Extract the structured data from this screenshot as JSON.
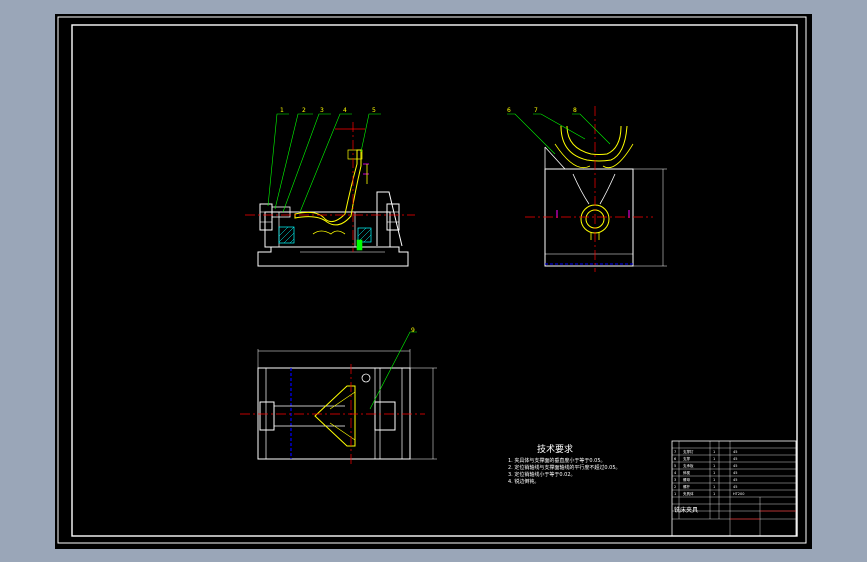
{
  "drawing": {
    "technical_requirements": {
      "title": "技术要求",
      "items": [
        "1. 夹具体与支撑面的垂直度小于等于0.05。",
        "2. 定位销轴线与支撑面轴线的平行度不超过0.05。",
        "3. 定位销轴线小于等于0.02。",
        "4. 锐边倒钝。"
      ]
    },
    "part_labels": [
      "1",
      "2",
      "3",
      "4",
      "5",
      "6",
      "7",
      "8",
      "9"
    ],
    "title_block": {
      "drawing_name": "铣床夹具",
      "rows": [
        {
          "col1": "7",
          "col2": "支撑钉",
          "col3": "1",
          "col4": "45"
        },
        {
          "col1": "6",
          "col2": "支撑",
          "col3": "1",
          "col4": "45"
        },
        {
          "col1": "5",
          "col2": "支承板",
          "col3": "1",
          "col4": "45"
        },
        {
          "col1": "4",
          "col2": "斜楔",
          "col3": "1",
          "col4": "45"
        },
        {
          "col1": "3",
          "col2": "螺母",
          "col3": "1",
          "col4": "45"
        },
        {
          "col1": "2",
          "col2": "螺杆",
          "col3": "1",
          "col4": "45"
        },
        {
          "col1": "1",
          "col2": "夹具体",
          "col3": "1",
          "col4": "HT200"
        }
      ]
    }
  }
}
